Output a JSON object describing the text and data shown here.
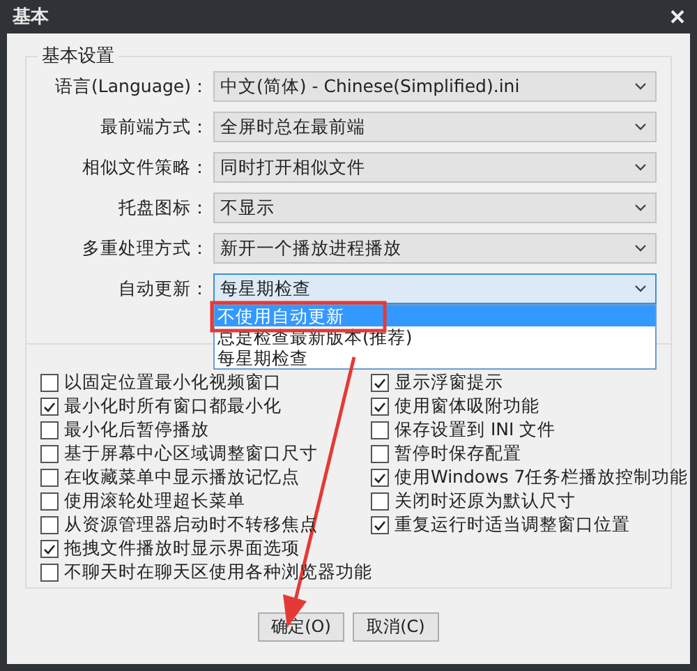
{
  "window": {
    "title": "基本"
  },
  "group": {
    "title": "基本设置"
  },
  "settings": [
    {
      "label": "语言(Language)：",
      "value": "中文(简体) - Chinese(Simplified).ini",
      "open": false
    },
    {
      "label": "最前端方式：",
      "value": "全屏时总在最前端",
      "open": false
    },
    {
      "label": "相似文件策略：",
      "value": "同时打开相似文件",
      "open": false
    },
    {
      "label": "托盘图标：",
      "value": "不显示",
      "open": false
    },
    {
      "label": "多重处理方式：",
      "value": "新开一个播放进程播放",
      "open": false
    },
    {
      "label": "自动更新：",
      "value": "每星期检查",
      "open": true
    }
  ],
  "dropdown_options": [
    {
      "label": "不使用自动更新",
      "selected": true
    },
    {
      "label": "总是检查最新版本(推荐)",
      "selected": false
    },
    {
      "label": "每星期检查",
      "selected": false
    }
  ],
  "checkboxes_left": [
    {
      "label": "以固定位置最小化视频窗口",
      "checked": false
    },
    {
      "label": "最小化时所有窗口都最小化",
      "checked": true
    },
    {
      "label": "最小化后暂停播放",
      "checked": false
    },
    {
      "label": "基于屏幕中心区域调整窗口尺寸",
      "checked": false
    },
    {
      "label": "在收藏菜单中显示播放记忆点",
      "checked": false
    },
    {
      "label": "使用滚轮处理超长菜单",
      "checked": false
    },
    {
      "label": "从资源管理器启动时不转移焦点",
      "checked": false
    },
    {
      "label": "拖拽文件播放时显示界面选项",
      "checked": true
    },
    {
      "label": "不聊天时在聊天区使用各种浏览器功能",
      "checked": false
    }
  ],
  "checkboxes_right": [
    {
      "label": "显示浮窗提示",
      "checked": true
    },
    {
      "label": "使用窗体吸附功能",
      "checked": true
    },
    {
      "label": "保存设置到 INI 文件",
      "checked": false
    },
    {
      "label": "暂停时保存配置",
      "checked": false
    },
    {
      "label": "使用Windows 7任务栏播放控制功能",
      "checked": true
    },
    {
      "label": "关闭时还原为默认尺寸",
      "checked": false
    },
    {
      "label": "重复运行时适当调整窗口位置",
      "checked": true
    }
  ],
  "buttons": [
    "确定(O)",
    "取消(C)"
  ]
}
